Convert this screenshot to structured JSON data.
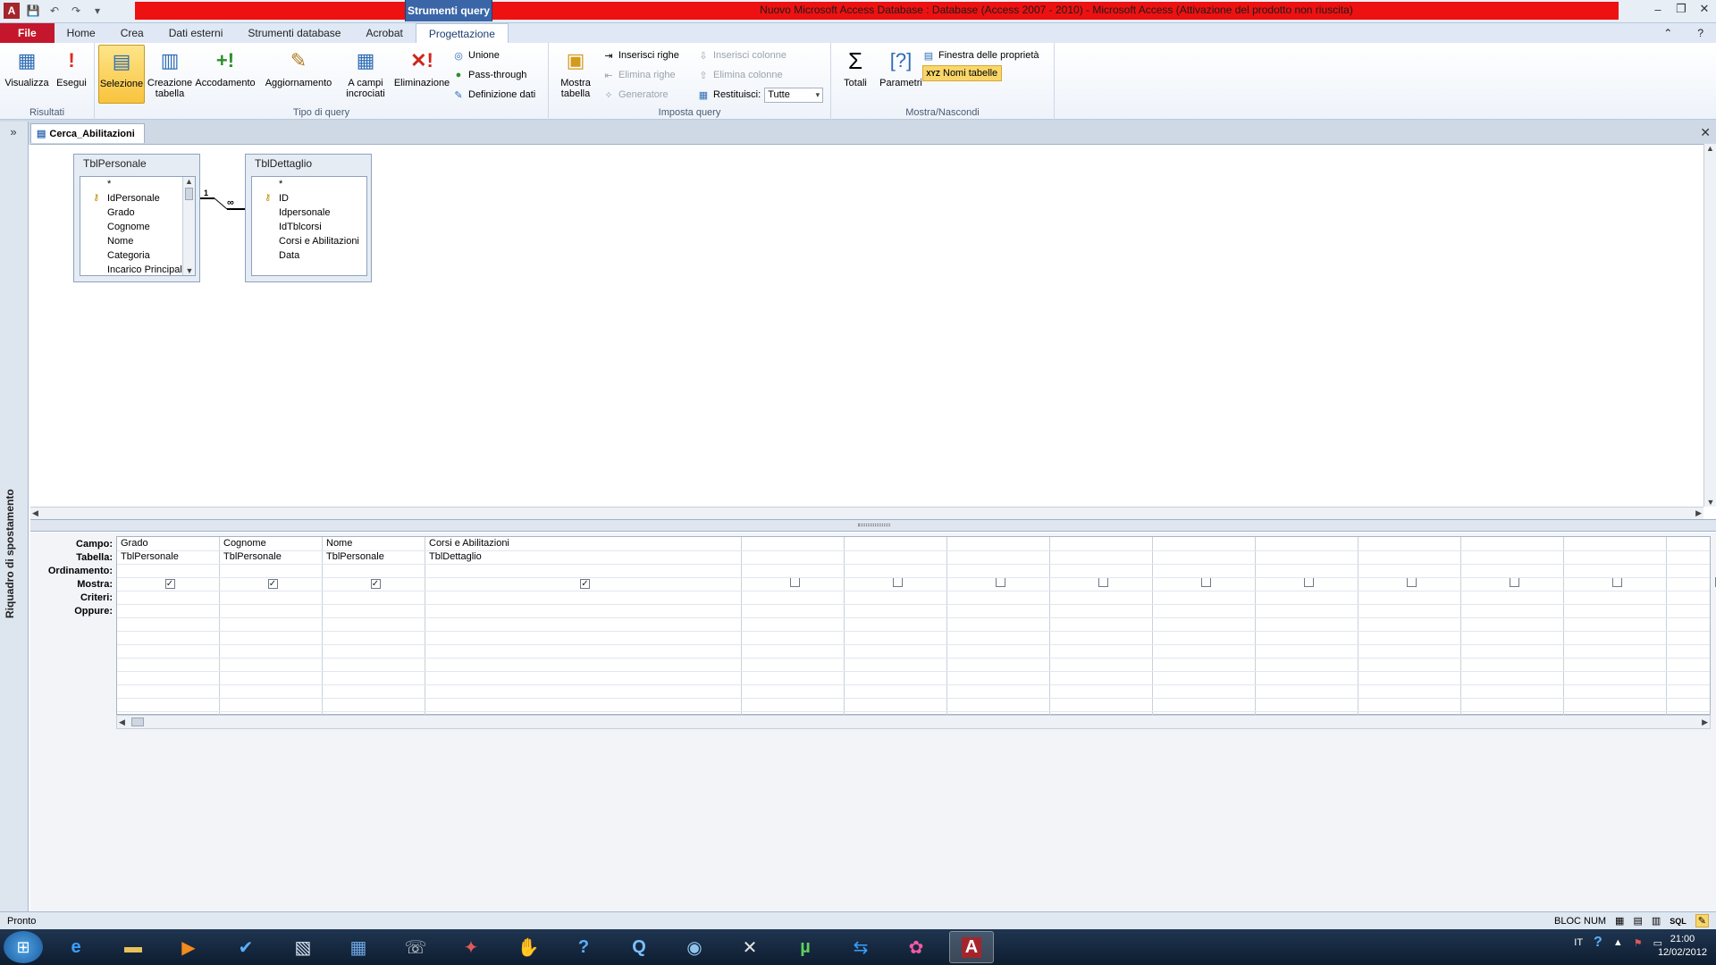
{
  "window": {
    "title": "Nuovo Microsoft Access Database : Database (Access 2007 - 2010)  -  Microsoft Access (Attivazione del prodotto non riuscita)",
    "contextual_tab": "Strumenti query"
  },
  "ribbon_tabs": [
    "File",
    "Home",
    "Crea",
    "Dati esterni",
    "Strumenti database",
    "Acrobat",
    "Progettazione"
  ],
  "ribbon": {
    "groups": {
      "risultati": "Risultati",
      "tipo_query": "Tipo di query",
      "imposta_query": "Imposta query",
      "mostra_nascondi": "Mostra/Nascondi"
    },
    "buttons": {
      "visualizza": "Visualizza",
      "esegui": "Esegui",
      "selezione": "Selezione",
      "creazione_tabella": "Creazione tabella",
      "accodamento": "Accodamento",
      "aggiornamento": "Aggiornamento",
      "a_campi_incrociati": "A campi incrociati",
      "eliminazione": "Eliminazione",
      "unione": "Unione",
      "pass_through": "Pass-through",
      "definizione_dati": "Definizione dati",
      "mostra_tabella": "Mostra tabella",
      "inserisci_righe": "Inserisci righe",
      "elimina_righe": "Elimina righe",
      "generatore": "Generatore",
      "inserisci_colonne": "Inserisci colonne",
      "elimina_colonne": "Elimina colonne",
      "restituisci_label": "Restituisci:",
      "restituisci_value": "Tutte",
      "totali": "Totali",
      "parametri": "Parametri",
      "finestra_proprieta": "Finestra delle proprietà",
      "nomi_tabelle": "Nomi tabelle"
    }
  },
  "nav_pane": {
    "label": "Riquadro di spostamento",
    "toggle": "»"
  },
  "document": {
    "tab": "Cerca_Abilitazioni"
  },
  "tables": [
    {
      "name": "TblPersonale",
      "fields": [
        "*",
        "IdPersonale",
        "Grado",
        "Cognome",
        "Nome",
        "Categoria",
        "Incarico Principale"
      ],
      "key_field": "IdPersonale"
    },
    {
      "name": "TblDettaglio",
      "fields": [
        "*",
        "ID",
        "Idpersonale",
        "IdTblcorsi",
        "Corsi e Abilitazioni",
        "Data"
      ],
      "key_field": "ID"
    }
  ],
  "relationship": {
    "one": "1",
    "many": "∞"
  },
  "grid": {
    "row_labels": [
      "Campo:",
      "Tabella:",
      "Ordinamento:",
      "Mostra:",
      "Criteri:",
      "Oppure:"
    ],
    "columns": [
      {
        "campo": "Grado",
        "tabella": "TblPersonale",
        "mostra": true
      },
      {
        "campo": "Cognome",
        "tabella": "TblPersonale",
        "mostra": true
      },
      {
        "campo": "Nome",
        "tabella": "TblPersonale",
        "mostra": true
      },
      {
        "campo": "Corsi e Abilitazioni",
        "tabella": "TblDettaglio",
        "mostra": true
      },
      {
        "campo": "",
        "tabella": "",
        "mostra": false
      },
      {
        "campo": "",
        "tabella": "",
        "mostra": false
      },
      {
        "campo": "",
        "tabella": "",
        "mostra": false
      },
      {
        "campo": "",
        "tabella": "",
        "mostra": false
      },
      {
        "campo": "",
        "tabella": "",
        "mostra": false
      },
      {
        "campo": "",
        "tabella": "",
        "mostra": false
      },
      {
        "campo": "",
        "tabella": "",
        "mostra": false
      },
      {
        "campo": "",
        "tabella": "",
        "mostra": false
      },
      {
        "campo": "",
        "tabella": "",
        "mostra": false
      },
      {
        "campo": "",
        "tabella": "",
        "mostra": false
      }
    ]
  },
  "status": {
    "left": "Pronto",
    "bloc_num": "BLOC NUM",
    "sql": "SQL"
  },
  "taskbar": {
    "language": "IT",
    "time": "21:00",
    "date": "12/02/2012"
  },
  "colors": {
    "title_red": "#ee1111",
    "file_tab": "#c4162c",
    "selected_button": "#f9c33d"
  }
}
